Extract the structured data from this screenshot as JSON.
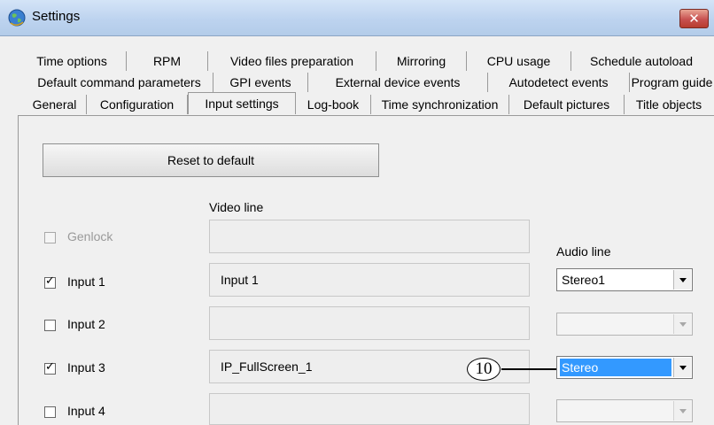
{
  "window": {
    "title": "Settings",
    "icon": "globe-icon",
    "close_glyph": "✕"
  },
  "tabs": {
    "row1": [
      "Time options",
      "RPM",
      "Video files preparation",
      "Mirroring",
      "CPU usage",
      "Schedule autoload"
    ],
    "row2": [
      "Default command parameters",
      "GPI events",
      "External device events",
      "Autodetect events",
      "Program guide"
    ],
    "row3": [
      "General",
      "Configuration",
      "Input settings",
      "Log-book",
      "Time synchronization",
      "Default pictures",
      "Title objects"
    ],
    "active": "Input settings"
  },
  "panel": {
    "reset_button": "Reset to default",
    "video_line_header": "Video line",
    "audio_line_header": "Audio line",
    "rows": [
      {
        "label": "Genlock",
        "checked": false,
        "disabled": true,
        "video": "",
        "audio": null
      },
      {
        "label": "Input 1",
        "checked": true,
        "disabled": false,
        "video": "Input 1",
        "audio": "Stereo1",
        "audio_enabled": true
      },
      {
        "label": "Input 2",
        "checked": false,
        "disabled": false,
        "video": "",
        "audio": "",
        "audio_enabled": false
      },
      {
        "label": "Input 3",
        "checked": true,
        "disabled": false,
        "video": "IP_FullScreen_1",
        "audio": "Stereo",
        "audio_enabled": true,
        "audio_highlighted": true
      },
      {
        "label": "Input 4",
        "checked": false,
        "disabled": false,
        "video": "",
        "audio": "",
        "audio_enabled": false
      }
    ],
    "check_glyph": "✓"
  },
  "callout": {
    "number": "10"
  },
  "colors": {
    "titlebar": "#bdd3ef",
    "close_button": "#c75050",
    "selection": "#3399ff",
    "panel": "#f0f0f0"
  }
}
